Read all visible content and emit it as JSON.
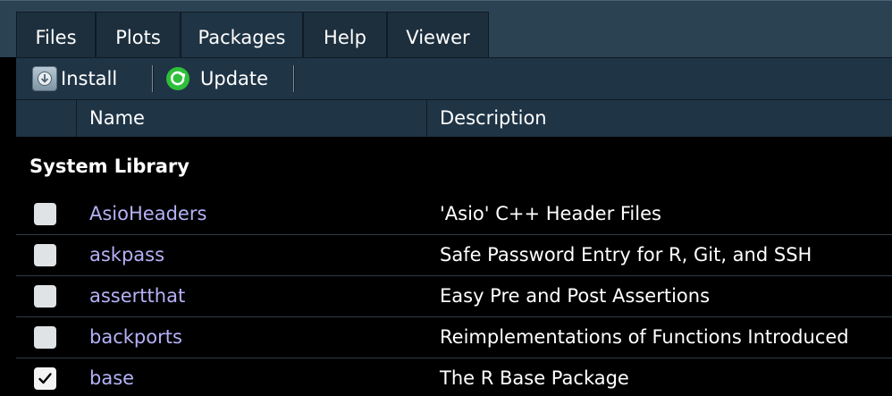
{
  "tabs": [
    {
      "label": "Files",
      "active": false
    },
    {
      "label": "Plots",
      "active": false
    },
    {
      "label": "Packages",
      "active": true
    },
    {
      "label": "Help",
      "active": false
    },
    {
      "label": "Viewer",
      "active": false
    }
  ],
  "toolbar": {
    "install_label": "Install",
    "install_icon": "install-icon",
    "update_label": "Update",
    "update_icon": "refresh-icon"
  },
  "table": {
    "columns": [
      "",
      "Name",
      "Description"
    ],
    "group_label": "System Library",
    "rows": [
      {
        "checked": false,
        "name": "AsioHeaders",
        "description": "'Asio' C++ Header Files"
      },
      {
        "checked": false,
        "name": "askpass",
        "description": "Safe Password Entry for R, Git, and SSH"
      },
      {
        "checked": false,
        "name": "assertthat",
        "description": "Easy Pre and Post Assertions"
      },
      {
        "checked": false,
        "name": "backports",
        "description": "Reimplementations of Functions Introduced"
      },
      {
        "checked": true,
        "name": "base",
        "description": "The R Base Package"
      }
    ]
  },
  "colors": {
    "tabbar_bg": "#2b4253",
    "panel_bg": "#1f3445",
    "body_bg": "#000000",
    "package_link": "#b5b1f7",
    "update_icon_green": "#2fbf3a"
  }
}
